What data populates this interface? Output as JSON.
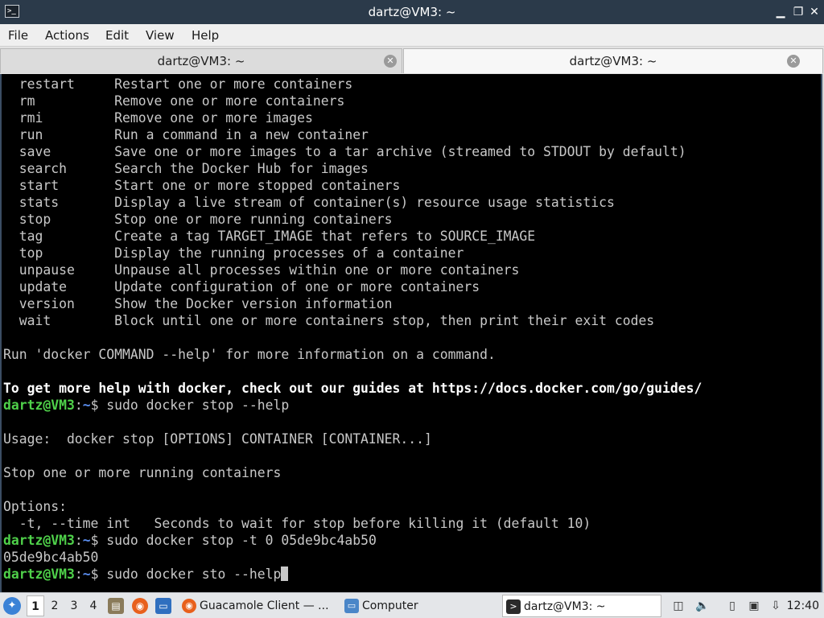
{
  "window": {
    "title": "dartz@VM3: ~",
    "minimize_glyph": "▁",
    "maximize_glyph": "❐",
    "close_glyph": "✕"
  },
  "menu": [
    "File",
    "Actions",
    "Edit",
    "View",
    "Help"
  ],
  "tabs": [
    {
      "label": "dartz@VM3: ~",
      "active": false
    },
    {
      "label": "dartz@VM3: ~",
      "active": true
    }
  ],
  "terminal": {
    "lines": [
      {
        "type": "plain",
        "text": "  restart     Restart one or more containers"
      },
      {
        "type": "plain",
        "text": "  rm          Remove one or more containers"
      },
      {
        "type": "plain",
        "text": "  rmi         Remove one or more images"
      },
      {
        "type": "plain",
        "text": "  run         Run a command in a new container"
      },
      {
        "type": "plain",
        "text": "  save        Save one or more images to a tar archive (streamed to STDOUT by default)"
      },
      {
        "type": "plain",
        "text": "  search      Search the Docker Hub for images"
      },
      {
        "type": "plain",
        "text": "  start       Start one or more stopped containers"
      },
      {
        "type": "plain",
        "text": "  stats       Display a live stream of container(s) resource usage statistics"
      },
      {
        "type": "plain",
        "text": "  stop        Stop one or more running containers"
      },
      {
        "type": "plain",
        "text": "  tag         Create a tag TARGET_IMAGE that refers to SOURCE_IMAGE"
      },
      {
        "type": "plain",
        "text": "  top         Display the running processes of a container"
      },
      {
        "type": "plain",
        "text": "  unpause     Unpause all processes within one or more containers"
      },
      {
        "type": "plain",
        "text": "  update      Update configuration of one or more containers"
      },
      {
        "type": "plain",
        "text": "  version     Show the Docker version information"
      },
      {
        "type": "plain",
        "text": "  wait        Block until one or more containers stop, then print their exit codes"
      },
      {
        "type": "plain",
        "text": ""
      },
      {
        "type": "plain",
        "text": "Run 'docker COMMAND --help' for more information on a command."
      },
      {
        "type": "plain",
        "text": ""
      },
      {
        "type": "bold",
        "text": "To get more help with docker, check out our guides at https://docs.docker.com/go/guides/"
      },
      {
        "type": "prompt",
        "user": "dartz@VM3",
        "path": "~",
        "text": "$ sudo docker stop --help"
      },
      {
        "type": "plain",
        "text": ""
      },
      {
        "type": "plain",
        "text": "Usage:  docker stop [OPTIONS] CONTAINER [CONTAINER...]"
      },
      {
        "type": "plain",
        "text": ""
      },
      {
        "type": "plain",
        "text": "Stop one or more running containers"
      },
      {
        "type": "plain",
        "text": ""
      },
      {
        "type": "plain",
        "text": "Options:"
      },
      {
        "type": "plain",
        "text": "  -t, --time int   Seconds to wait for stop before killing it (default 10)"
      },
      {
        "type": "prompt",
        "user": "dartz@VM3",
        "path": "~",
        "text": "$ sudo docker stop -t 0 05de9bc4ab50"
      },
      {
        "type": "plain",
        "text": "05de9bc4ab50"
      },
      {
        "type": "prompt",
        "user": "dartz@VM3",
        "path": "~",
        "text": "$ sudo docker sto --help",
        "cursor": true
      }
    ]
  },
  "taskbar": {
    "workspaces": [
      "1",
      "2",
      "3",
      "4"
    ],
    "tasks": [
      {
        "label": "Guacamole Client — ...",
        "icon": "firefox-icon"
      },
      {
        "label": "Computer",
        "icon": "folder-icon"
      },
      {
        "label": "dartz@VM3: ~",
        "icon": "terminal-icon"
      }
    ],
    "clock": "12:40"
  },
  "colors": {
    "terminal_bg": "#000000",
    "terminal_fg": "#c8c8c8",
    "prompt_user": "#4fd14a",
    "prompt_path": "#5b8ef0",
    "titlebar_bg": "#2b3a4a"
  }
}
